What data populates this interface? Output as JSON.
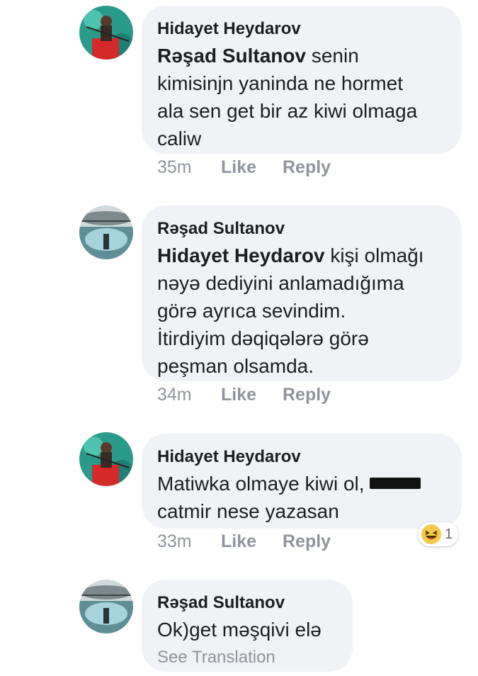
{
  "comments": [
    {
      "author": "Hidayet Heydarov",
      "mention": "Rəşad Sultanov",
      "text_lines": [
        " senin",
        "kimisinjn yaninda ne hormet",
        "ala sen get bir az kiwi olmaga",
        "caliw"
      ],
      "time": "35m",
      "like": "Like",
      "reply": "Reply"
    },
    {
      "author": "Rəşad Sultanov",
      "mention": "Hidayet Heydarov",
      "text_lines": [
        " kişi olmağı",
        "nəyə dediyini anlamadığıma",
        "görə ayrıca sevindim.",
        "İtirdiyim dəqiqələrə görə",
        "peşman olsamda."
      ],
      "time": "34m",
      "like": "Like",
      "reply": "Reply"
    },
    {
      "author": "Hidayet Heydarov",
      "text_line1": "Matiwka olmaye kiwi ol, ",
      "text_line2": "catmir nese yazasan",
      "time": "33m",
      "like": "Like",
      "reply": "Reply",
      "reaction": {
        "icon": "laughing-emoji-icon",
        "count": "1"
      }
    },
    {
      "author": "Rəşad Sultanov",
      "text": "Ok)get məşqivi elə",
      "see_translation": "See Translation"
    }
  ],
  "colors": {
    "bubble": "#f0f2f5",
    "meta_text": "#90949c",
    "name_text": "#1c1e21"
  }
}
